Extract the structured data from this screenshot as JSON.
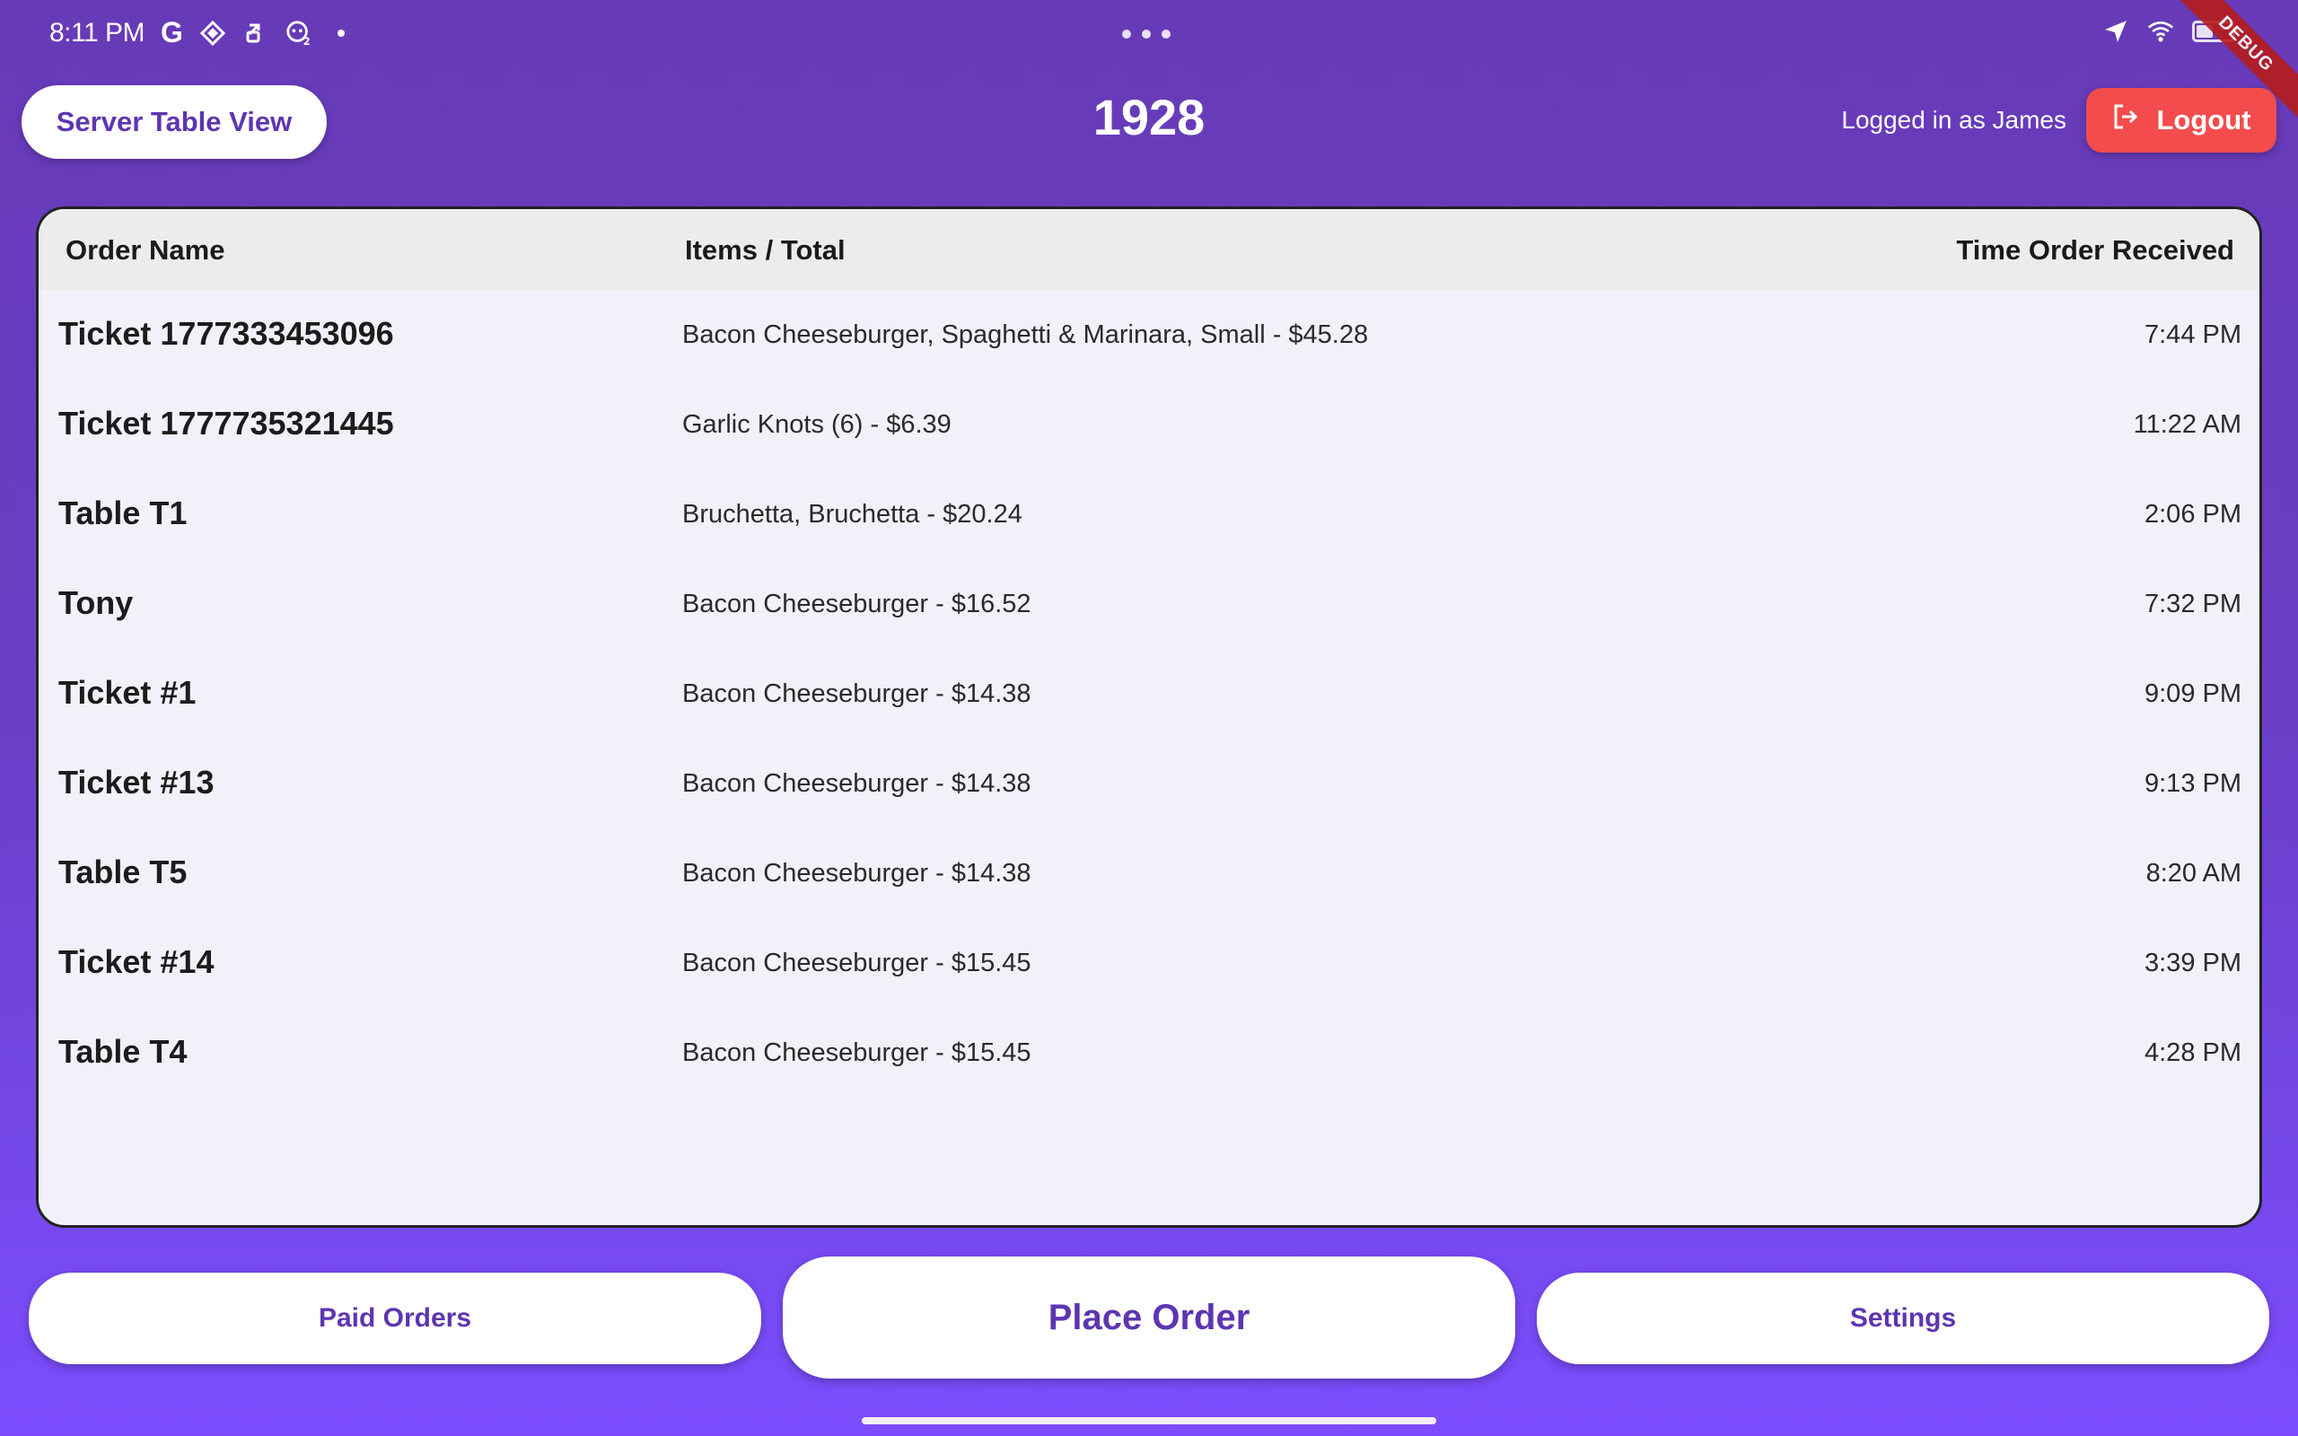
{
  "status_bar": {
    "time": "8:11 PM",
    "google_glyph": "G",
    "icons": [
      "google-icon",
      "diamond-icon",
      "sync-icon",
      "game-controller-icon",
      "dot-icon"
    ],
    "right_icons": [
      "location-arrow-icon",
      "wifi-icon",
      "battery-icon"
    ],
    "debug_label": "DEBUG"
  },
  "header": {
    "left_button_label": "Server Table View",
    "title": "1928",
    "logged_in_text": "Logged in as James",
    "logout_label": "Logout"
  },
  "table": {
    "columns": {
      "name": "Order Name",
      "items": "Items / Total",
      "time": "Time Order Received"
    },
    "rows": [
      {
        "name": "Ticket 1777333453096",
        "items": "Bacon Cheeseburger, Spaghetti & Marinara, Small  -  $45.28",
        "time": "7:44 PM"
      },
      {
        "name": "Ticket 1777735321445",
        "items": "Garlic Knots (6)  -  $6.39",
        "time": "11:22 AM"
      },
      {
        "name": "Table T1",
        "items": "Bruchetta, Bruchetta  -  $20.24",
        "time": "2:06 PM"
      },
      {
        "name": "Tony",
        "items": "Bacon Cheeseburger  -  $16.52",
        "time": "7:32 PM"
      },
      {
        "name": "Ticket #1",
        "items": "Bacon Cheeseburger  -  $14.38",
        "time": "9:09 PM"
      },
      {
        "name": "Ticket #13",
        "items": "Bacon Cheeseburger  -  $14.38",
        "time": "9:13 PM"
      },
      {
        "name": "Table T5",
        "items": "Bacon Cheeseburger  -  $14.38",
        "time": "8:20 AM"
      },
      {
        "name": "Ticket #14",
        "items": "Bacon Cheeseburger  -  $15.45",
        "time": "3:39 PM"
      },
      {
        "name": "Table T4",
        "items": "Bacon Cheeseburger  -  $15.45",
        "time": "4:28 PM"
      }
    ]
  },
  "footer": {
    "paid_orders_label": "Paid Orders",
    "place_order_label": "Place Order",
    "settings_label": "Settings"
  },
  "colors": {
    "accent": "#5e35b1",
    "logout": "#f44c4c",
    "background_top": "#673ab7",
    "background_bottom": "#7c4dff"
  }
}
